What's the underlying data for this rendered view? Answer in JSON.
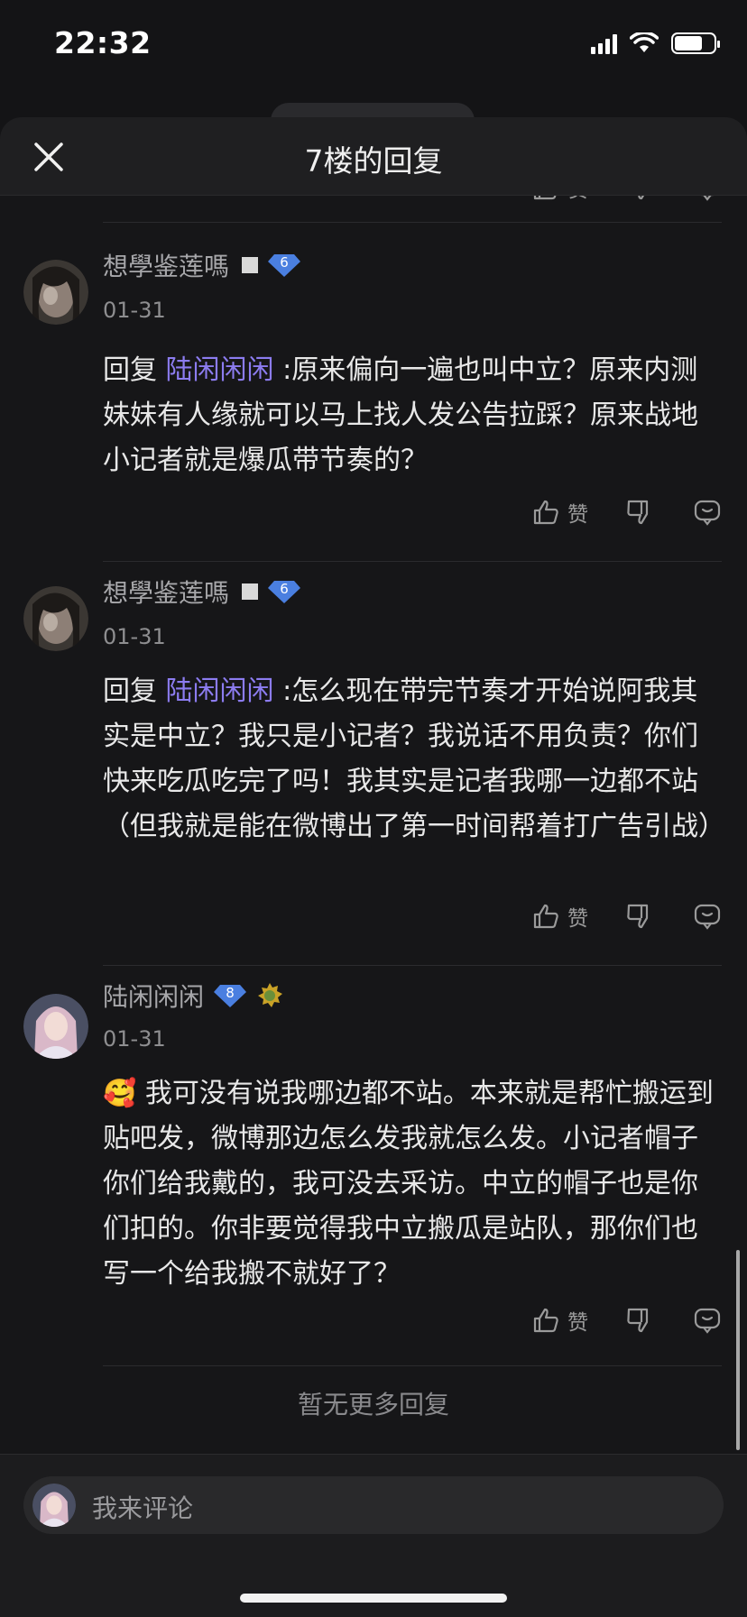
{
  "status_bar": {
    "time": "22:32"
  },
  "header": {
    "title": "7楼的回复"
  },
  "actions": {
    "like_label": "赞"
  },
  "comments": [
    {
      "username": "想學鉴莲嗎",
      "level": "6",
      "date": "01-31",
      "reply_prefix": "回复",
      "mention": "陆闲闲闲",
      "text": ":原来偏向一遍也叫中立？原来内测妹妹有人缘就可以马上找人发公告拉踩？原来战地小记者就是爆瓜带节奏的？"
    },
    {
      "username": "想學鉴莲嗎",
      "level": "6",
      "date": "01-31",
      "reply_prefix": "回复",
      "mention": "陆闲闲闲",
      "text": ":怎么现在带完节奏才开始说阿我其实是中立？我只是小记者？我说话不用负责？你们快来吃瓜吃完了吗！我其实是记者我哪一边都不站（但我就是能在微博出了第一时间帮着打广告引战）"
    },
    {
      "username": "陆闲闲闲",
      "level": "8",
      "date": "01-31",
      "emoji": "🥰",
      "text": "我可没有说我哪边都不站。本来就是帮忙搬运到贴吧发，微博那边怎么发我就怎么发。小记者帽子你们给我戴的，我可没去采访。中立的帽子也是你们扣的。你非要觉得我中立搬瓜是站队，那你们也写一个给我搬不就好了？"
    }
  ],
  "footer": {
    "no_more": "暂无更多回复"
  },
  "comment_input": {
    "placeholder": "我来评论"
  },
  "colors": {
    "mention": "#8c7cf0",
    "level_gem": "#4a7fe0",
    "background": "#161618"
  }
}
